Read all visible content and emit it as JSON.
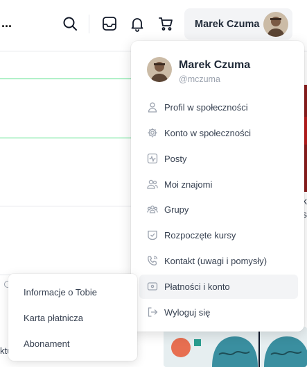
{
  "header": {
    "more_label": "...",
    "icons": [
      "search-icon",
      "inbox-icon",
      "bell-icon",
      "cart-icon"
    ],
    "user_button_name": "Marek Czuma"
  },
  "background": {
    "right_edge_chars": [
      "k",
      "s"
    ],
    "left_edge_text": "ktu"
  },
  "profile_menu": {
    "name": "Marek Czuma",
    "handle": "@mczuma",
    "items": [
      {
        "label": "Profil w społeczności",
        "icon": "user-icon"
      },
      {
        "label": "Konto w społeczności",
        "icon": "settings-icon"
      },
      {
        "label": "Posty",
        "icon": "activity-icon"
      },
      {
        "label": "Moi znajomi",
        "icon": "friends-icon"
      },
      {
        "label": "Grupy",
        "icon": "groups-icon"
      },
      {
        "label": "Rozpoczęte kursy",
        "icon": "course-icon"
      },
      {
        "label": "Kontakt (uwagi i pomysły)",
        "icon": "phone-icon"
      },
      {
        "label": "Płatności i konto",
        "icon": "payment-icon"
      },
      {
        "label": "Wyloguj się",
        "icon": "logout-icon"
      }
    ],
    "active_item": "Płatności i konto"
  },
  "submenu": {
    "items": [
      "Informacje o Tobie",
      "Karta płatnicza",
      "Abonament"
    ]
  },
  "colors": {
    "accent_green": "#4ade80",
    "active_bg": "#f3f4f6",
    "text": "#374151"
  }
}
